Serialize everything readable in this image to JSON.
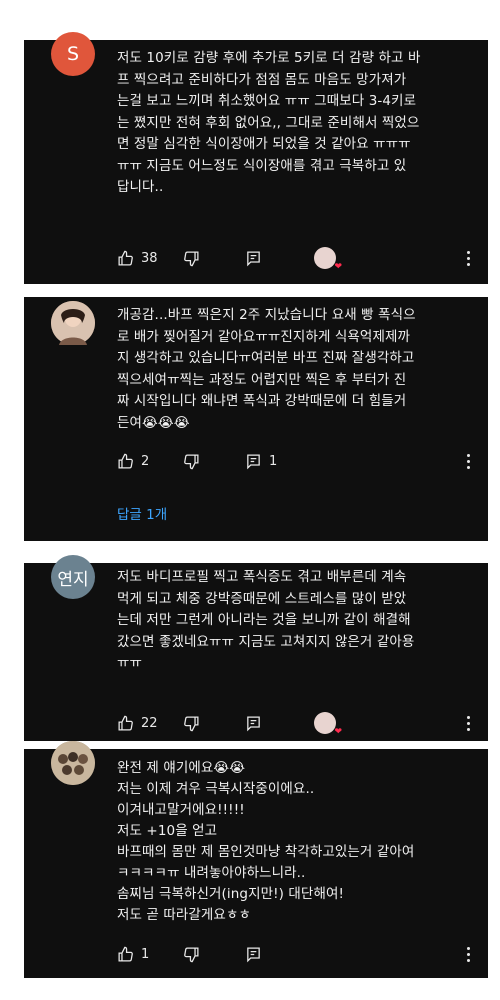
{
  "comments": [
    {
      "avatar_letter": "S",
      "text": "저도 10키로 감량 후에 추가로 5키로 더 감량 하고 바\n프 찍으려고 준비하다가 점점 몸도 마음도 망가져가\n는걸 보고 느끼며 취소했어요 ㅠㅠ 그때보다 3-4키로\n는 쪘지만 전혀 후회 없어요,, 그대로 준비해서 찍었으\n면 정말 심각한 식이장애가 되었을 것 같아요 ㅠㅠㅠ\nㅠㅠ 지금도 어느정도 식이장애를 겪고 극복하고 있\n답니다..",
      "likes": "38"
    },
    {
      "text": "개공감...바프 찍은지 2주 지났습니다 요새 빵 폭식으\n로 배가 찢어질거 같아요ㅠㅠ진지하게 식욕억제제까\n지 생각하고 있습니다ㅠ여러분 바프 진짜 잘생각하고\n찍으세여ㅠ찍는 과정도 어렵지만 찍은 후 부터가 진\n짜 시작입니다 왜냐면 폭식과 강박때문에 더 힘들거\n든여😭😭😭",
      "likes": "2",
      "replies": "1",
      "reply_link": "답글 1개"
    },
    {
      "avatar_text": "연지",
      "text": "저도 바디프로필 찍고 폭식증도 겪고 배부른데 계속\n먹게 되고 체중 강박증때문에 스트레스를 많이 받았\n는데 저만 그런게 아니라는 것을 보니까 같이 해결해\n갔으면 좋겠네요ㅠㅠ 지금도 고쳐지지 않은거 같아용\nㅠㅠ",
      "likes": "22"
    },
    {
      "text": "완전 제 얘기에요😭😭\n저는 이제 겨우 극복시작중이에요..\n이겨내고말거에요!!!!!\n저도 +10을 얻고\n바프때의 몸만 제 몸인것마냥 착각하고있는거 같아여\nㅋㅋㅋㅋㅠ 내려놓아야하느니라..\n솜찌님 극복하신거(ing지만!) 대단해여!\n저도 곧 따라갈게요ㅎㅎ",
      "likes": "1"
    }
  ],
  "colors": {
    "card_bg": "#0f0f0f",
    "text": "#f1f1f1",
    "link": "#3ea6ff"
  }
}
